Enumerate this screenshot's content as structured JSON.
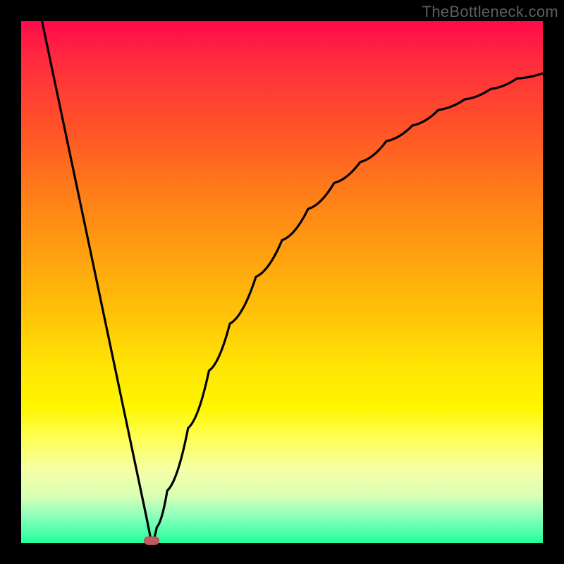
{
  "watermark": "TheBottleneck.com",
  "colors": {
    "background": "#000000",
    "curve": "#000000",
    "min_marker": "#c4595f"
  },
  "chart_data": {
    "type": "line",
    "title": "",
    "xlabel": "",
    "ylabel": "",
    "xlim": [
      0,
      100
    ],
    "ylim": [
      0,
      100
    ],
    "grid": false,
    "description": "Bottleneck-style V curve: steep linear drop from x≈4 at y=100 to minimum near x≈25 y≈0, then a concave rise toward y≈90 at x=100.",
    "series": [
      {
        "name": "bottleneck-curve",
        "x": [
          4,
          8,
          12,
          16,
          20,
          24,
          25,
          26,
          28,
          32,
          36,
          40,
          45,
          50,
          55,
          60,
          65,
          70,
          75,
          80,
          85,
          90,
          95,
          100
        ],
        "y": [
          100,
          81,
          62,
          43,
          24,
          5,
          0,
          3,
          10,
          22,
          33,
          42,
          51,
          58,
          64,
          69,
          73,
          77,
          80,
          83,
          85,
          87,
          89,
          90
        ]
      }
    ],
    "minimum": {
      "x_pct": 25,
      "y_pct": 0
    }
  }
}
